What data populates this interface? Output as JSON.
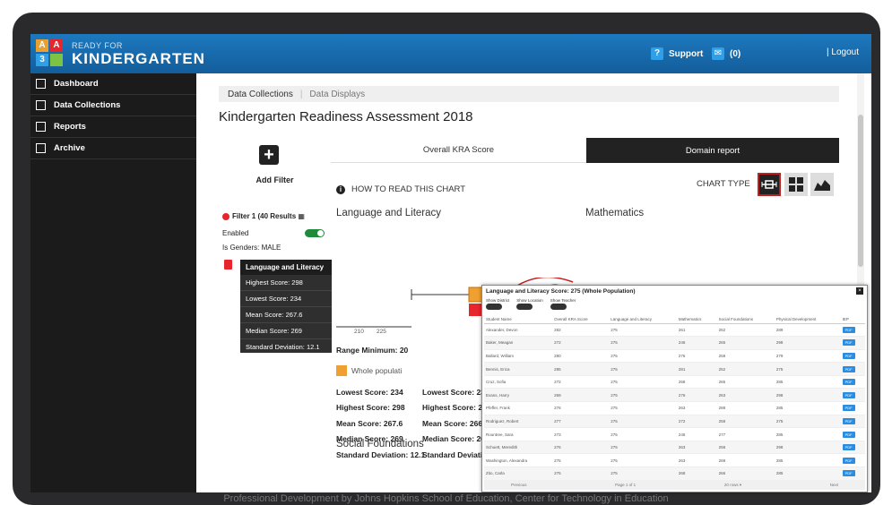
{
  "header": {
    "brand_small": "READY FOR",
    "brand_big": "KINDERGARTEN",
    "logo_letters": [
      "A",
      "A",
      "3",
      "■"
    ],
    "support_label": "Support",
    "messages_label": "(0)",
    "logout_label": "| Logout"
  },
  "sidebar": {
    "items": [
      {
        "label": "Dashboard"
      },
      {
        "label": "Data Collections"
      },
      {
        "label": "Reports"
      },
      {
        "label": "Archive"
      }
    ]
  },
  "breadcrumb": {
    "active": "Data Collections",
    "inactive": "Data Displays"
  },
  "page_title": "Kindergarten Readiness Assessment 2018",
  "filter_panel": {
    "add_filter_label": "Add Filter",
    "filter_name": "Filter 1 (40 Results",
    "enabled_label": "Enabled",
    "condition": "Is Genders: MALE"
  },
  "tabs": {
    "overall": "Overall KRA Score",
    "domain": "Domain report"
  },
  "howto_label": "HOW TO READ THIS CHART",
  "chart_type_label": "CHART TYPE",
  "domains": {
    "language": "Language and Literacy",
    "math": "Mathematics",
    "social": "Social Foundations"
  },
  "axis_ticks": [
    "210",
    "225"
  ],
  "legend": {
    "whole_population": "Whole populati"
  },
  "stats_left": {
    "range_min": "Range Minimum: 20",
    "lowest_label": "Lowest Score:",
    "lowest": "234",
    "highest_label": "Highest Score:",
    "highest": "298",
    "mean_label": "Mean Score:",
    "mean": "267.6",
    "median_label": "Median Score:",
    "median": "269",
    "sd_label": "Standard Deviation:",
    "sd": "12.1"
  },
  "stats_right": {
    "lowest": "Lowest Score: 23",
    "highest": "Highest Score: 29",
    "mean": "Mean Score: 266.",
    "median": "Median Score: 26",
    "sd": "Standard Deviatio"
  },
  "tooltip": {
    "title": "Language and Literacy",
    "rows": [
      "Highest Score: 298",
      "Lowest Score: 234",
      "Mean Score: 267.6",
      "Median Score: 269",
      "Standard Deviation: 12.1"
    ]
  },
  "overlay": {
    "title": "Language and Literacy Score: 275 (Whole Population)",
    "toggles": [
      "Show District",
      "Show Location",
      "Show Teacher"
    ],
    "columns": [
      "Student Name",
      "Overall KRA Score",
      "Language and Literacy",
      "Mathematics",
      "Social Foundations",
      "Physical Development",
      "IEP"
    ],
    "rows": [
      [
        "Alexander, Devon",
        "282",
        "275",
        "261",
        "252",
        "289"
      ],
      [
        "Baker, Meagan",
        "272",
        "275",
        "246",
        "265",
        "298"
      ],
      [
        "Ballard, William",
        "280",
        "275",
        "276",
        "258",
        "279"
      ],
      [
        "Bennis, Erica",
        "285",
        "275",
        "281",
        "252",
        "275"
      ],
      [
        "Cruz, Sofia",
        "272",
        "275",
        "258",
        "265",
        "285"
      ],
      [
        "Evans, Harry",
        "269",
        "275",
        "276",
        "263",
        "298"
      ],
      [
        "Pfeffer, Frank",
        "276",
        "275",
        "263",
        "288",
        "285"
      ],
      [
        "Rodriguez, Robert",
        "277",
        "275",
        "272",
        "258",
        "275"
      ],
      [
        "Rountree, Sara",
        "273",
        "275",
        "245",
        "277",
        "285"
      ],
      [
        "Schuett, Meredith",
        "276",
        "275",
        "263",
        "258",
        "298"
      ],
      [
        "Washington, Alexandra",
        "275",
        "275",
        "263",
        "268",
        "285"
      ],
      [
        "Zito, Carla",
        "275",
        "275",
        "268",
        "266",
        "285"
      ]
    ],
    "pdf_label": "PDF",
    "footer": {
      "previous": "Previous",
      "page": "Page   1   of 1",
      "rows": "20 rows  ▾",
      "next": "Next"
    }
  },
  "footer_text": "Professional Development by Johns Hopkins School of Education, Center for Technology in Education",
  "colors": {
    "header_blue": "#1d79bf",
    "sidebar_bg": "#1b1b1b",
    "orange_box": "#f0a030",
    "red_box": "#e6252c",
    "purple_box": "#9b30d0",
    "toggle_green": "#1f8b3a"
  }
}
